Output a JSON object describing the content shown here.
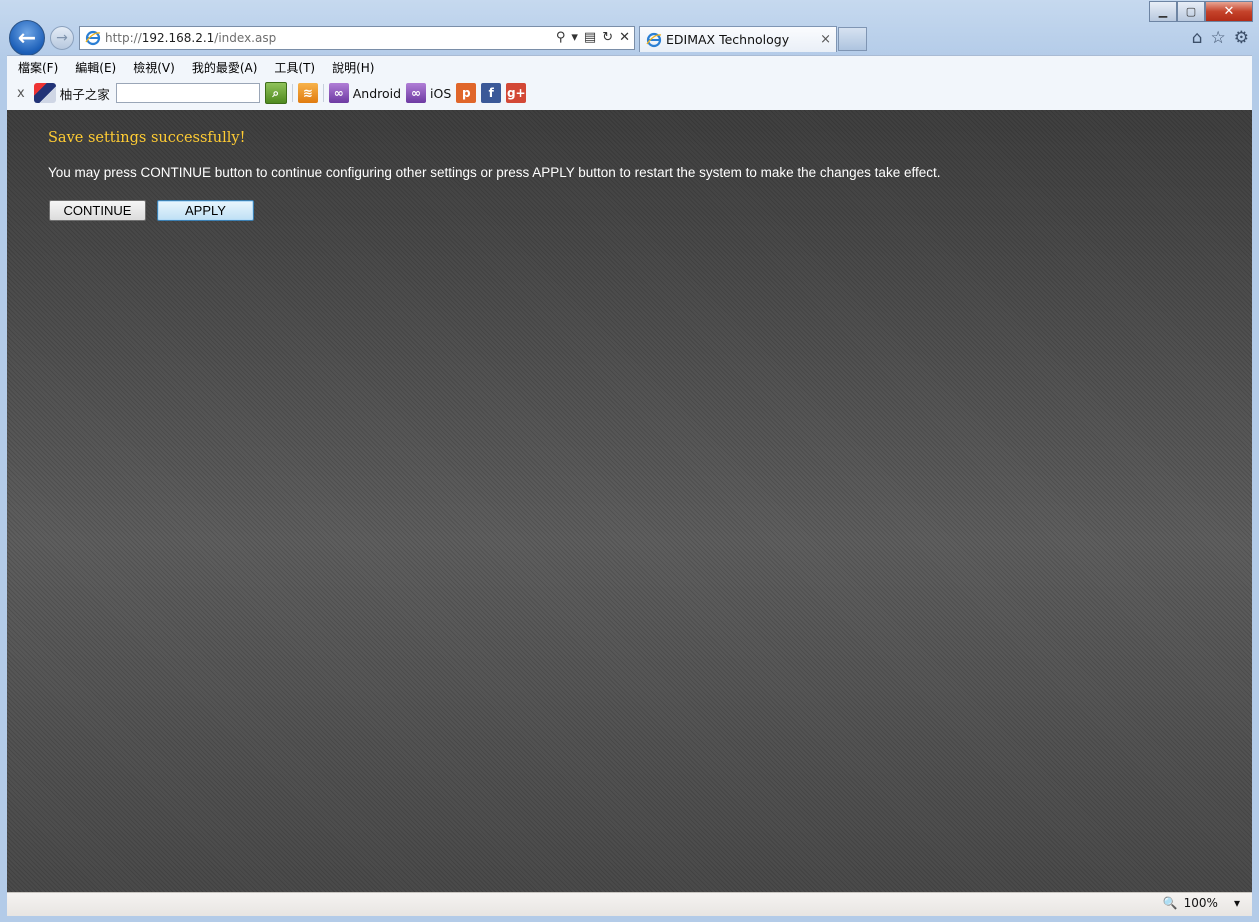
{
  "window": {
    "controls": {
      "minimize": "▁",
      "maximize": "▢",
      "close": "✕"
    }
  },
  "nav": {
    "back_icon": "←",
    "forward_icon": "→"
  },
  "address": {
    "url_prefix": "http://",
    "url_host": "192.168.2.1",
    "url_path": "/index.asp",
    "search_icon": "⚲",
    "dropdown_icon": "▾",
    "compat_icon": "▤",
    "refresh_icon": "↻",
    "stop_icon": "✕"
  },
  "tab": {
    "title": "EDIMAX Technology",
    "close": "×"
  },
  "right_icons": {
    "home": "⌂",
    "favorites": "☆",
    "tools": "⚙"
  },
  "menu": {
    "items": [
      "檔案(F)",
      "編輯(E)",
      "檢視(V)",
      "我的最愛(A)",
      "工具(T)",
      "說明(H)"
    ]
  },
  "toolbar": {
    "close": "x",
    "site_name": "柚子之家",
    "search_go": "⌕",
    "rss": "≋",
    "link1_label": "Android",
    "link2_label": "iOS",
    "p_icon": "p",
    "fb_icon": "f",
    "gplus_icon": "g+"
  },
  "content": {
    "title": "Save settings successfully!",
    "message": "You may press CONTINUE button to continue configuring other settings or press APPLY button to restart the system to make the changes take effect.",
    "continue_label": "CONTINUE",
    "apply_label": "APPLY"
  },
  "status": {
    "zoom": "100%",
    "zoom_dropdown": "▾"
  }
}
